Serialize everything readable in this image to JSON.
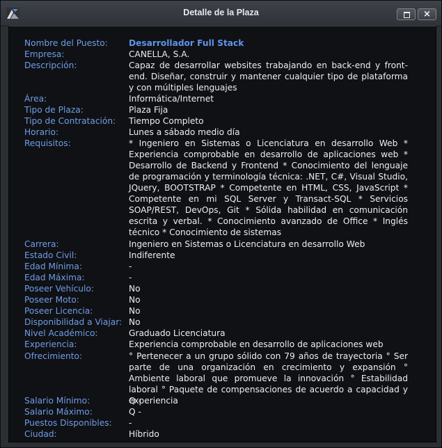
{
  "window": {
    "title": "Detalle de la Plaza",
    "close_glyph": "×",
    "icons": {
      "app": "app-logo-icon",
      "restore": "restore-icon",
      "close": "close-icon"
    }
  },
  "colors": {
    "label": "#6f9de8",
    "value": "#eceef1",
    "highlight": "#5f94ec",
    "content_bg": "#101114",
    "chrome_bg": "#2b2e33"
  },
  "fields": {
    "puesto": {
      "label": "Nombre del Puesto:",
      "value": "Desarrollador Full Stack"
    },
    "empresa": {
      "label": "Empresa:",
      "value": "CANELLA, S.A."
    },
    "descripcion": {
      "label": "Descripción:",
      "value": "Capaz de desarrollar websites trabajando en back-end y front-end. Diseñar, construir y mantener cualquier tipo de plataforma y con múltiples lenguajes"
    },
    "area": {
      "label": "Área:",
      "value": "Informática/Internet"
    },
    "tipo_plaza": {
      "label": "Tipo de Plaza:",
      "value": "Plaza Fija"
    },
    "tipo_contratacion": {
      "label": "Tipo de Contratación:",
      "value": "Tiempo Completo"
    },
    "horario": {
      "label": "Horario:",
      "value": "Lunes a sábado medio día"
    },
    "requisitos": {
      "label": "Requisitos:",
      "value": "* Ingeniero en Sistemas o Licenciatura en desarrollo Web * Experiencia comprobable en desarrollo de aplicaciones web * Desarrollo de Backend y Frontend * Conocimiento del lenguaje de programación y terminología técnica: .NET, C#, Visual Studio, JQuery, BOOTSTRAP * Competente en HTML, CSS, JavaScript * Competente en mi SQL Server y Transact-SQL * Servicios SOAP/REST, DevOps, Git * Sólida habilidad en comunicación escrita y verbal. * Conocimiento avanzado de Office * Inglés técnico * Conocimiento de sistemas"
    },
    "carrera": {
      "label": "Carrera:",
      "value": "Ingeniero en Sistemas o Licenciatura en desarrollo Web"
    },
    "estado_civil": {
      "label": "Estado Civil:",
      "value": "Indiferente"
    },
    "edad_minima": {
      "label": "Edad Mínima:",
      "value": "-"
    },
    "edad_maxima": {
      "label": "Edad Máxima:",
      "value": "-"
    },
    "vehiculo": {
      "label": "Poseer Vehículo:",
      "value": "No"
    },
    "moto": {
      "label": "Poseer Moto:",
      "value": "No"
    },
    "licencia": {
      "label": "Poseer Licencia:",
      "value": "No"
    },
    "viajar": {
      "label": "Disponibilidad a Viajar:",
      "value": "No"
    },
    "nivel_academico": {
      "label": "Nivel Académico:",
      "value": "Graduado Licenciatura"
    },
    "experiencia": {
      "label": "Experiencia:",
      "value": "Experiencia comprobable en desarrollo de aplicaciones web"
    },
    "ofrecimiento": {
      "label": "Ofrecimiento:",
      "value": "° Pertenecer a un grupo sólido con 79 años de trayectoria ° Ser parte de una organización en crecimiento y expansión ° Ambiente laboral que promueve la innovación ° Estabilidad laboral ° Paquete de compensaciones de acuerdo a capacidad y experiencia"
    },
    "salario_minimo": {
      "label": "Salario Mínimo:",
      "value": "Q -"
    },
    "salario_maximo": {
      "label": "Salario Máximo:",
      "value": "Q -"
    },
    "puestos": {
      "label": "Puestos Disponibles:",
      "value": "-"
    },
    "ciudad": {
      "label": "Ciudad:",
      "value": "Híbrido"
    }
  }
}
